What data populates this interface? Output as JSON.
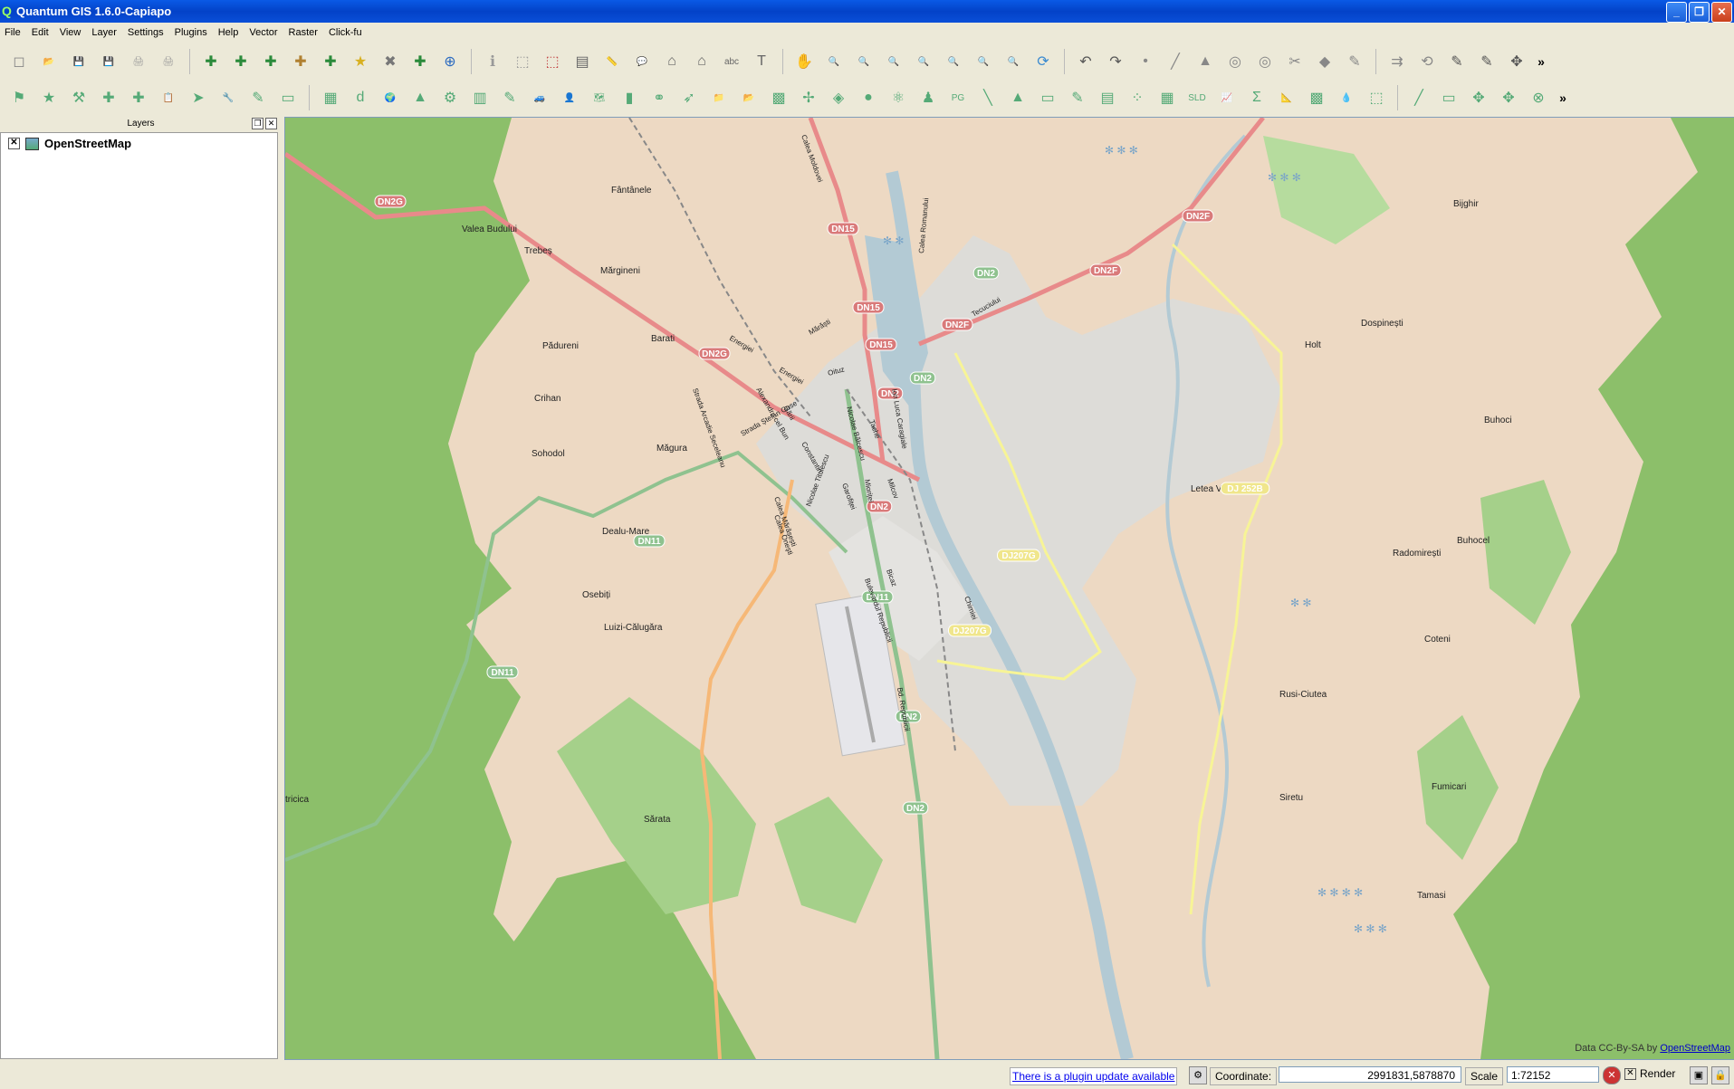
{
  "window": {
    "title": "Quantum GIS 1.6.0-Capiapo",
    "icon": "qgis-icon"
  },
  "menu": [
    "File",
    "Edit",
    "View",
    "Layer",
    "Settings",
    "Plugins",
    "Help",
    "Vector",
    "Raster",
    "Click-fu"
  ],
  "layers_panel": {
    "title": "Layers",
    "layers": [
      {
        "name": "OpenStreetMap",
        "checked": true
      }
    ]
  },
  "map": {
    "attribution_prefix": "Data CC-By-SA by ",
    "attribution_link": "OpenStreetMap",
    "places": [
      "Fântânele",
      "Valea Budului",
      "Trebeș",
      "Mărgineni",
      "Barati",
      "Pădureni",
      "Crihan",
      "Sohodol",
      "Măgura",
      "Dealu-Mare",
      "Osebiți",
      "Luizi-Călugăra",
      "Sărata",
      "tricica",
      "Bijghir",
      "Dospinești",
      "Holt",
      "Letea Veche",
      "Buhoci",
      "Buhocel",
      "Radomirești",
      "Coteni",
      "Rusi-Ciutea",
      "Fumicari",
      "Siretu",
      "Tamasi"
    ],
    "shields": [
      "DN2G",
      "DN15",
      "DN15",
      "DN15",
      "DN2G",
      "DN2",
      "DN2",
      "DN2",
      "DN2F",
      "DN2F",
      "DN2F",
      "DN2",
      "DN11",
      "DN11",
      "DN11",
      "DJ207G",
      "DJ207G",
      "DJ 252B",
      "DN2",
      "DN2"
    ],
    "streets": [
      "Energiei",
      "Energiei",
      "Mărăști",
      "Oituz",
      "Alexandru cel Bun",
      "Gării",
      "Nicolae Bălcescu",
      "Ion Luca Caragiale",
      "Strada Arcadie Seceleanu",
      "Strada Ștefan Guse",
      "Constantin",
      "Garofiței",
      "Calea Moldovei",
      "Tache",
      "Calea Romanului",
      "Tecuciului",
      "Calea Mărășești",
      "Milcov",
      "Nicolae Titulescu",
      "Calea Oneşti",
      "Bulevardul Republicii",
      "Bd. Republicii",
      "Chimiei",
      "Mioriței",
      "Bicaz"
    ]
  },
  "status": {
    "plugin_update": "There is a plugin update available",
    "coordinate_label": "Coordinate:",
    "coordinate_value": "2991831,5878870",
    "scale_label": "Scale",
    "scale_value": "1:72152",
    "render_label": "Render"
  },
  "toolbar1_icons": [
    "new-project-icon",
    "open-project-icon",
    "save-project-icon",
    "save-as-icon",
    "print-composer-icon",
    "composer-manager-icon",
    "add-vector-layer-icon",
    "add-raster-layer-icon",
    "add-postgis-layer-icon",
    "add-spatialite-layer-icon",
    "add-wms-layer-icon",
    "new-vector-layer-icon",
    "remove-layer-icon",
    "add-wfs-layer-icon",
    "gps-icon",
    "identify-icon",
    "select-icon",
    "deselect-icon",
    "attribute-table-icon",
    "measure-line-icon",
    "map-tips-icon",
    "home-bookmark-icon",
    "new-bookmark-icon",
    "label-icon",
    "annotation-icon",
    "pan-icon",
    "zoom-in-icon",
    "zoom-out-icon",
    "zoom-full-icon",
    "zoom-selection-icon",
    "zoom-layer-icon",
    "zoom-last-icon",
    "zoom-next-icon",
    "refresh-icon",
    "undo-icon",
    "redo-icon",
    "add-point-icon",
    "add-line-icon",
    "add-polygon-icon",
    "add-ring-icon",
    "delete-ring-icon",
    "split-icon",
    "node-icon",
    "reshape-icon",
    "offset-icon",
    "rotate-icon",
    "digitize-icon",
    "capture-icon",
    "move-feature-icon"
  ],
  "toolbar2_icons": [
    "plugin-icon",
    "star-icon",
    "tools-icon",
    "add-feature-icon",
    "copy-feature-icon",
    "paste-icon",
    "move-icon",
    "wrench-icon",
    "edit-icon",
    "page-icon",
    "grid-icon",
    "d2s-icon",
    "globe-icon",
    "histogram-icon",
    "network-icon",
    "database-icon",
    "table-edit-icon",
    "car-icon",
    "user-icon",
    "map-icon",
    "green-icon",
    "binoculars-icon",
    "compass-icon",
    "folder-icon",
    "open-folder-icon",
    "grid-tool-icon",
    "coordinates-icon",
    "cube-icon",
    "sphere-icon",
    "atom-icon",
    "person-icon",
    "pgps-icon",
    "link-icon",
    "mountain-icon",
    "monitor-icon",
    "pencil-icon",
    "stack-icon",
    "scatter-icon",
    "raster-icon",
    "sld-icon",
    "chart-icon",
    "sum-icon",
    "ruler-icon",
    "palette-icon",
    "drop-icon",
    "select-tool-icon",
    "line-edit-icon",
    "save-edit-icon",
    "move-vertex-icon",
    "node-tool-icon",
    "close-tool-icon"
  ],
  "colors": {
    "forest": "#8cbf6a",
    "land": "#edd9c3",
    "road_primary": "#e88a8a",
    "road_trunk": "#8fc28f",
    "road_secondary": "#f6b877",
    "water": "#b3cad4",
    "urban": "#dcdcdc",
    "titlebar": "#0a4fd8"
  }
}
